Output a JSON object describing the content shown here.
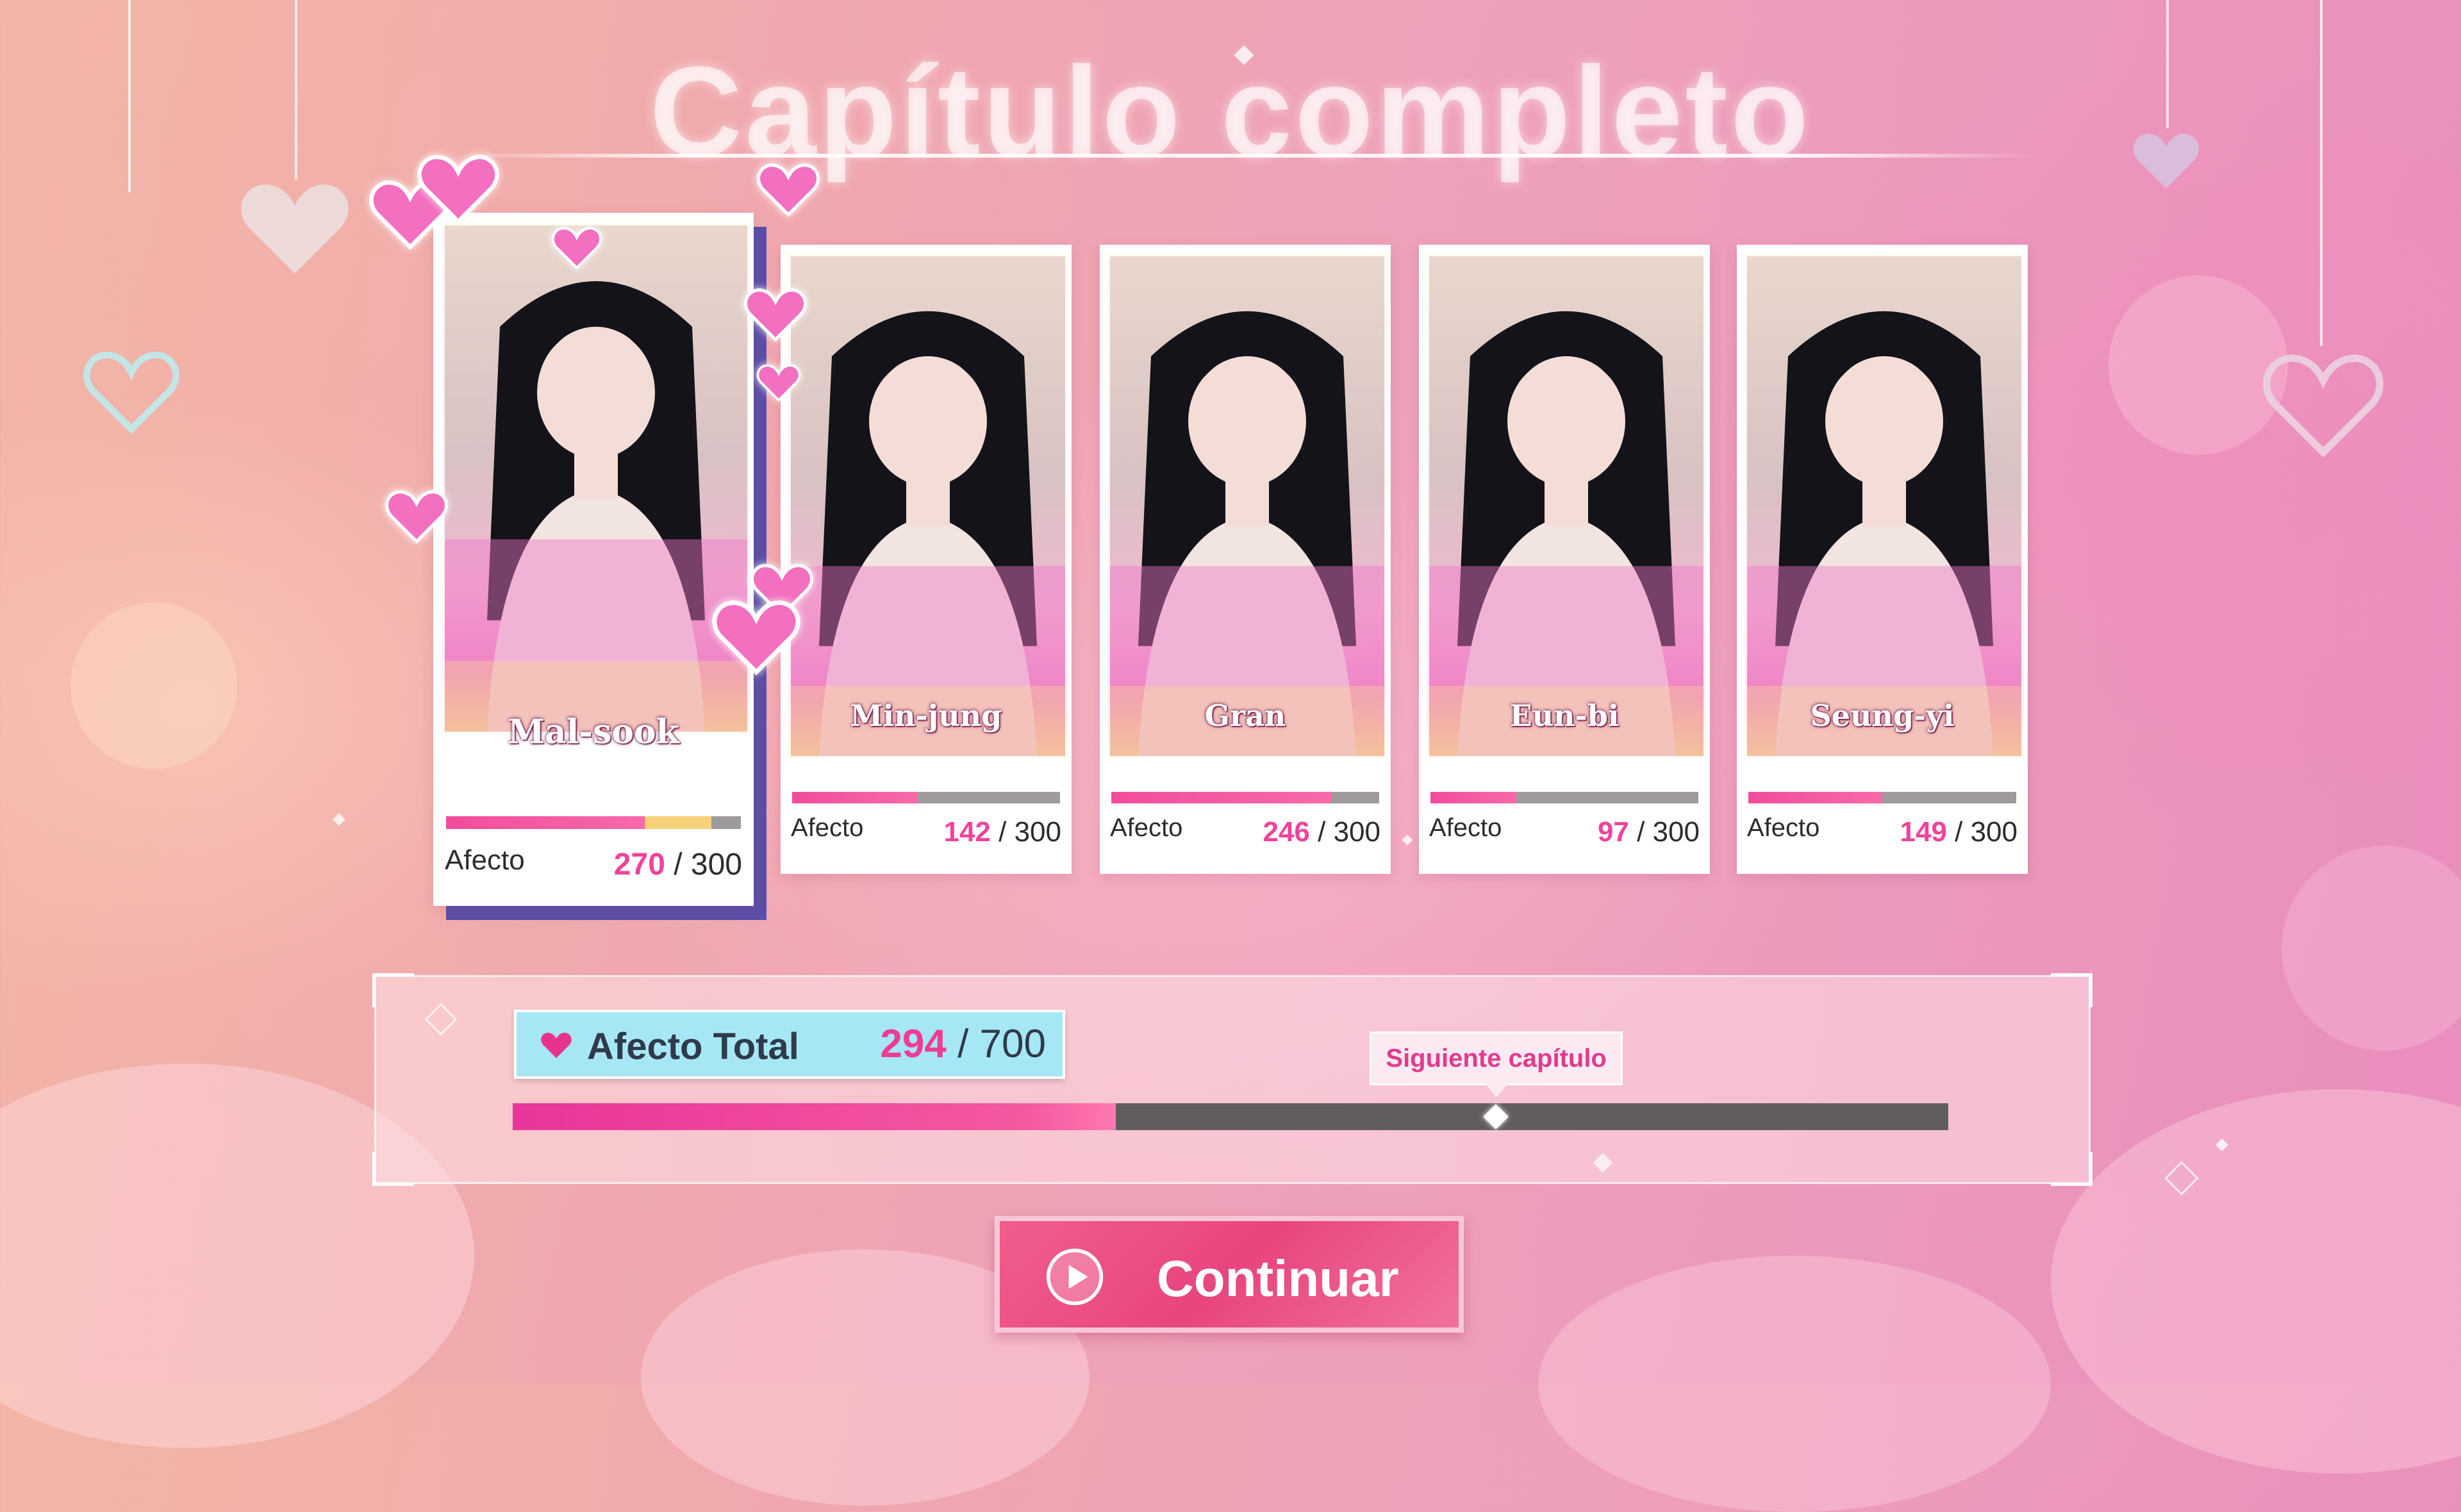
{
  "screen": {
    "title": "Capítulo completo"
  },
  "characters": [
    {
      "name": "Mal-sook",
      "label": "Afecto",
      "current": "270",
      "max": "/ 300",
      "fraction": 0.9,
      "highlighted": true
    },
    {
      "name": "Min-jung",
      "label": "Afecto",
      "current": "142",
      "max": "/ 300",
      "fraction": 0.47,
      "highlighted": false
    },
    {
      "name": "Gran",
      "label": "Afecto",
      "current": "246",
      "max": "/ 300",
      "fraction": 0.82,
      "highlighted": false
    },
    {
      "name": "Eun-bi",
      "label": "Afecto",
      "current": "97",
      "max": "/ 300",
      "fraction": 0.32,
      "highlighted": false
    },
    {
      "name": "Seung-yi",
      "label": "Afecto",
      "current": "149",
      "max": "/ 300",
      "fraction": 0.5,
      "highlighted": false
    }
  ],
  "total": {
    "label": "Afecto Total",
    "current": "294",
    "max": "/ 700",
    "fraction": 0.42,
    "next_chapter_label": "Siguiente capítulo",
    "next_chapter_fraction": 0.685
  },
  "actions": {
    "continue_label": "Continuar"
  },
  "colors": {
    "accent_pink": "#f0439a",
    "total_box": "#a6e7f5",
    "button": "#e8457e"
  },
  "icons": {
    "heart": "heart-icon",
    "play": "play-icon"
  }
}
